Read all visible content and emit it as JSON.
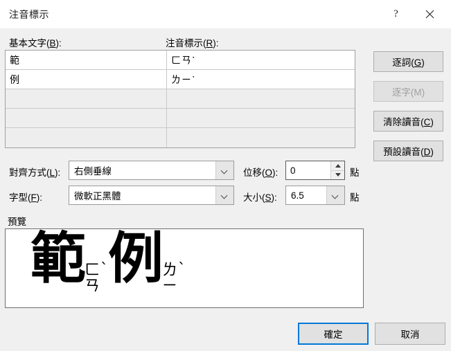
{
  "window": {
    "title": "注音標示",
    "help_icon": "question-mark-icon",
    "close_icon": "close-icon"
  },
  "columns": {
    "base_label": "基本文字(B):",
    "base_label_plain": "基本文字",
    "base_accel": "B",
    "ruby_label": "注音標示(R):",
    "ruby_label_plain": "注音標示",
    "ruby_accel": "R"
  },
  "rows": [
    {
      "base": "範",
      "ruby": "ㄈㄢˋ"
    },
    {
      "base": "例",
      "ruby": "ㄌㄧˋ"
    },
    {
      "base": "",
      "ruby": ""
    },
    {
      "base": "",
      "ruby": ""
    },
    {
      "base": "",
      "ruby": ""
    }
  ],
  "side_buttons": [
    {
      "label": "逐詞(G)",
      "text": "逐詞",
      "accel": "G",
      "enabled": true
    },
    {
      "label": "逐字(M)",
      "text": "逐字",
      "accel": "M",
      "enabled": false
    },
    {
      "label": "清除讀音(C)",
      "text": "清除讀音",
      "accel": "C",
      "enabled": true
    },
    {
      "label": "預設讀音(D)",
      "text": "預設讀音",
      "accel": "D",
      "enabled": true
    }
  ],
  "fields": {
    "alignment": {
      "label": "對齊方式(L):",
      "label_plain": "對齊方式",
      "accel": "L",
      "value": "右側垂線"
    },
    "offset": {
      "label": "位移(O):",
      "label_plain": "位移",
      "accel": "O",
      "value": "0",
      "unit": "點"
    },
    "font": {
      "label": "字型(F):",
      "label_plain": "字型",
      "accel": "F",
      "value": "微軟正黑體"
    },
    "size": {
      "label": "大小(S):",
      "label_plain": "大小",
      "accel": "S",
      "value": "6.5",
      "unit": "點"
    }
  },
  "preview": {
    "label": "預覽",
    "items": [
      {
        "base": "範",
        "initial": "ㄈ",
        "final": "ㄢ",
        "tone": "ˋ"
      },
      {
        "base": "例",
        "initial": "ㄌ",
        "final": "ㄧ",
        "tone": "ˋ"
      }
    ]
  },
  "footer": {
    "ok_label": "確定",
    "cancel_label": "取消"
  },
  "colors": {
    "dialog_bg": "#f0f0f0",
    "titlebar_bg": "#ffffff",
    "accent": "#0078d7",
    "button_face": "#e1e1e1",
    "disabled_text": "#a0a0a0",
    "field_bg": "#ffffff",
    "grid_empty_bg": "#eeeeee"
  }
}
